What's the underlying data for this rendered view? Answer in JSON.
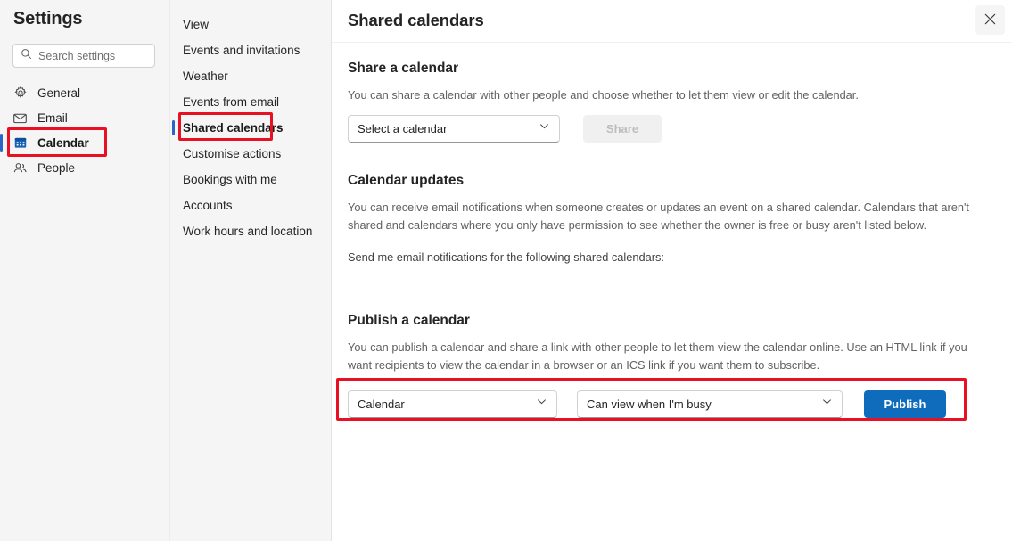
{
  "sidebar": {
    "title": "Settings",
    "search": {
      "placeholder": "Search settings",
      "value": "",
      "icon": "search-icon"
    },
    "items": [
      {
        "label": "General",
        "icon": "gear-icon",
        "selected": false
      },
      {
        "label": "Email",
        "icon": "envelope-icon",
        "selected": false
      },
      {
        "label": "Calendar",
        "icon": "calendar-icon",
        "selected": true
      },
      {
        "label": "People",
        "icon": "people-icon",
        "selected": false
      }
    ]
  },
  "subnav": {
    "items": [
      {
        "label": "View",
        "selected": false
      },
      {
        "label": "Events and invitations",
        "selected": false
      },
      {
        "label": "Weather",
        "selected": false
      },
      {
        "label": "Events from email",
        "selected": false
      },
      {
        "label": "Shared calendars",
        "selected": true
      },
      {
        "label": "Customise actions",
        "selected": false
      },
      {
        "label": "Bookings with me",
        "selected": false
      },
      {
        "label": "Accounts",
        "selected": false
      },
      {
        "label": "Work hours and location",
        "selected": false
      }
    ]
  },
  "header": {
    "title": "Shared calendars",
    "close_icon": "close-icon"
  },
  "share_section": {
    "title": "Share a calendar",
    "description": "You can share a calendar with other people and choose whether to let them view or edit the calendar.",
    "calendar_select": {
      "value": "Select a calendar",
      "chevron_icon": "chevron-down-icon"
    },
    "share_button": "Share"
  },
  "updates_section": {
    "title": "Calendar updates",
    "description": "You can receive email notifications when someone creates or updates an event on a shared calendar. Calendars that aren't shared and calendars where you only have permission to see whether the owner is free or busy aren't listed below.",
    "prompt": "Send me email notifications for the following shared calendars:"
  },
  "publish_section": {
    "title": "Publish a calendar",
    "description": "You can publish a calendar and share a link with other people to let them view the calendar online. Use an HTML link if you want recipients to view the calendar in a browser or an ICS link if you want them to subscribe.",
    "calendar_select": {
      "value": "Calendar",
      "chevron_icon": "chevron-down-icon"
    },
    "permission_select": {
      "value": "Can view when I'm busy",
      "chevron_icon": "chevron-down-icon"
    },
    "publish_button": "Publish"
  },
  "colors": {
    "accent": "#0f6cbd",
    "indicator": "#2b66c4",
    "annotation": "#e81123",
    "panel_bg": "#f5f5f5"
  }
}
